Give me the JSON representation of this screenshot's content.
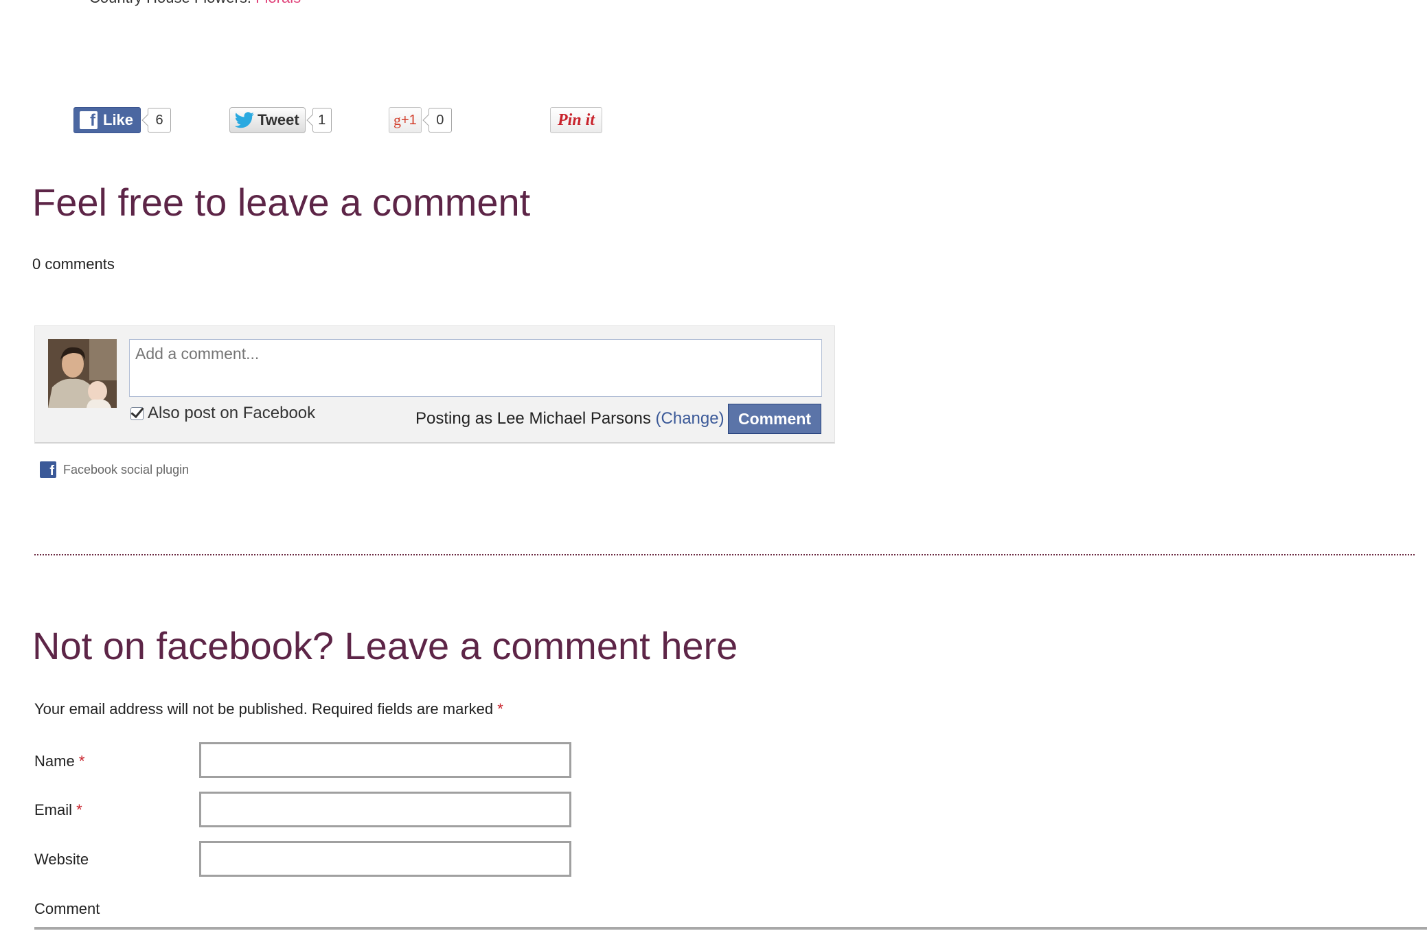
{
  "header": {
    "cut_text": "Country House Flowers.",
    "cut_link": "Florals"
  },
  "share": {
    "like_label": "Like",
    "like_count": "6",
    "tweet_label": "Tweet",
    "tweet_count": "1",
    "gplus_g": "g",
    "gplus_plus": "+1",
    "gplus_count": "0",
    "pin_label": "Pin it"
  },
  "fb_section": {
    "title": "Feel free to leave a comment",
    "comment_count": "0 comments",
    "comment_placeholder": "Add a comment...",
    "also_post_label": "Also post on Facebook",
    "posting_as_prefix": "Posting as Lee Michael Parsons ",
    "change_label": "(Change)",
    "comment_button": "Comment",
    "plugin_label": "Facebook social plugin",
    "plugin_icon_letter": "f",
    "icons": {
      "facebook": "facebook-f-icon",
      "twitter": "twitter-bird-icon",
      "checkbox": "checkbox-checked-icon"
    },
    "colors": {
      "facebook_blue": "#4b67a1",
      "heading_plum": "#5d2547",
      "required_red": "#c8232c"
    }
  },
  "form": {
    "title": "Not on facebook? Leave a comment here",
    "notice": "Your email address will not be published. Required fields are marked",
    "required_mark": "*",
    "name_label": "Name",
    "email_label": "Email",
    "website_label": "Website",
    "comment_label": "Comment"
  }
}
